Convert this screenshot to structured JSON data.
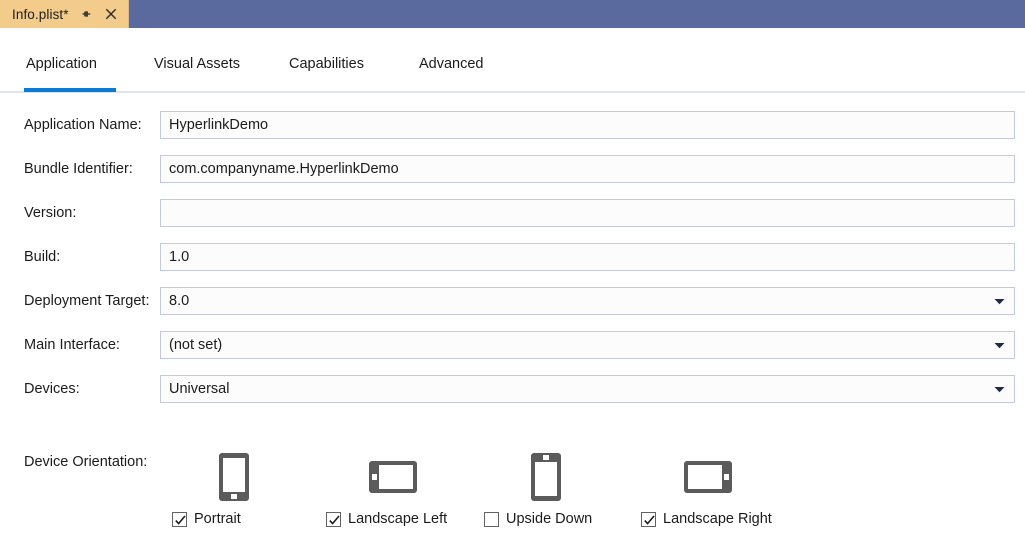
{
  "window": {
    "document_tab": {
      "title": "Info.plist*",
      "pin_icon": "pin-icon",
      "close_icon": "close-icon"
    },
    "titlebar_color": "#5b6a9e",
    "tab_color": "#f3cb8a"
  },
  "tabs": {
    "accent_color": "#0b7ad4",
    "items": [
      {
        "label": "Application",
        "active": true
      },
      {
        "label": "Visual Assets",
        "active": false
      },
      {
        "label": "Capabilities",
        "active": false
      },
      {
        "label": "Advanced",
        "active": false
      }
    ]
  },
  "form": {
    "fields": [
      {
        "label": "Application Name:",
        "value": "HyperlinkDemo",
        "type": "text"
      },
      {
        "label": "Bundle Identifier:",
        "value": "com.companyname.HyperlinkDemo",
        "type": "text"
      },
      {
        "label": "Version:",
        "value": "",
        "type": "text"
      },
      {
        "label": "Build:",
        "value": "1.0",
        "type": "text"
      },
      {
        "label": "Deployment Target:",
        "value": "8.0",
        "type": "combo"
      },
      {
        "label": "Main Interface:",
        "value": "(not set)",
        "type": "combo"
      },
      {
        "label": "Devices:",
        "value": "Universal",
        "type": "combo"
      }
    ]
  },
  "device_orientation": {
    "label": "Device Orientation:",
    "options": [
      {
        "label": "Portrait",
        "checked": true,
        "icon": "phone-portrait-icon"
      },
      {
        "label": "Landscape Left",
        "checked": true,
        "icon": "tablet-landscape-left-icon"
      },
      {
        "label": "Upside Down",
        "checked": false,
        "icon": "phone-upside-down-icon"
      },
      {
        "label": "Landscape Right",
        "checked": true,
        "icon": "tablet-landscape-right-icon"
      }
    ]
  }
}
